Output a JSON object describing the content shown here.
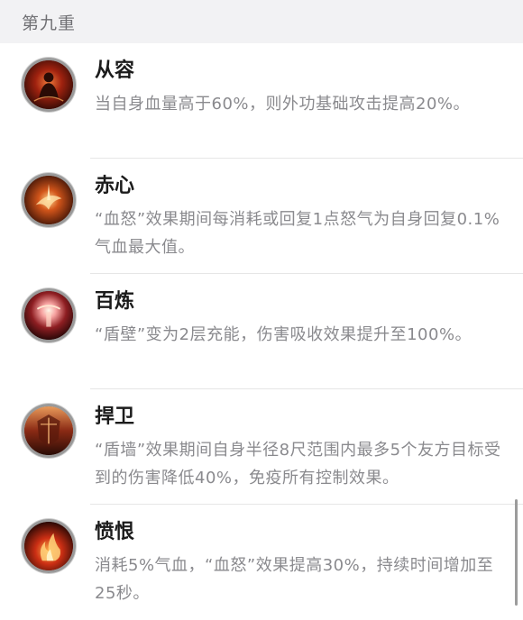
{
  "section": {
    "title": "第九重"
  },
  "skills": [
    {
      "name": "从容",
      "desc": "当自身血量高于60%，则外功基础攻击提高20%。",
      "icon": "meditating-figure-icon",
      "accent": "#b8321c"
    },
    {
      "name": "赤心",
      "desc": "“血怒”效果期间每消耗或回复1点怒气为自身回复0.1%气血最大值。",
      "icon": "fire-swirl-icon",
      "accent": "#d2551a"
    },
    {
      "name": "百炼",
      "desc": "“盾壁”变为2层充能，伤害吸收效果提升至100%。",
      "icon": "glowing-orb-icon",
      "accent": "#c23a3a"
    },
    {
      "name": "捍卫",
      "desc": "“盾墙”效果期间自身半径8尺范围内最多5个友方目标受到的伤害降低40%，免疫所有控制效果。",
      "icon": "armor-guard-icon",
      "accent": "#a3361c"
    },
    {
      "name": "愤恨",
      "desc": "消耗5%气血，“血怒”效果提高30%，持续时间增加至25秒。",
      "icon": "flame-icon",
      "accent": "#cc2f14"
    }
  ]
}
